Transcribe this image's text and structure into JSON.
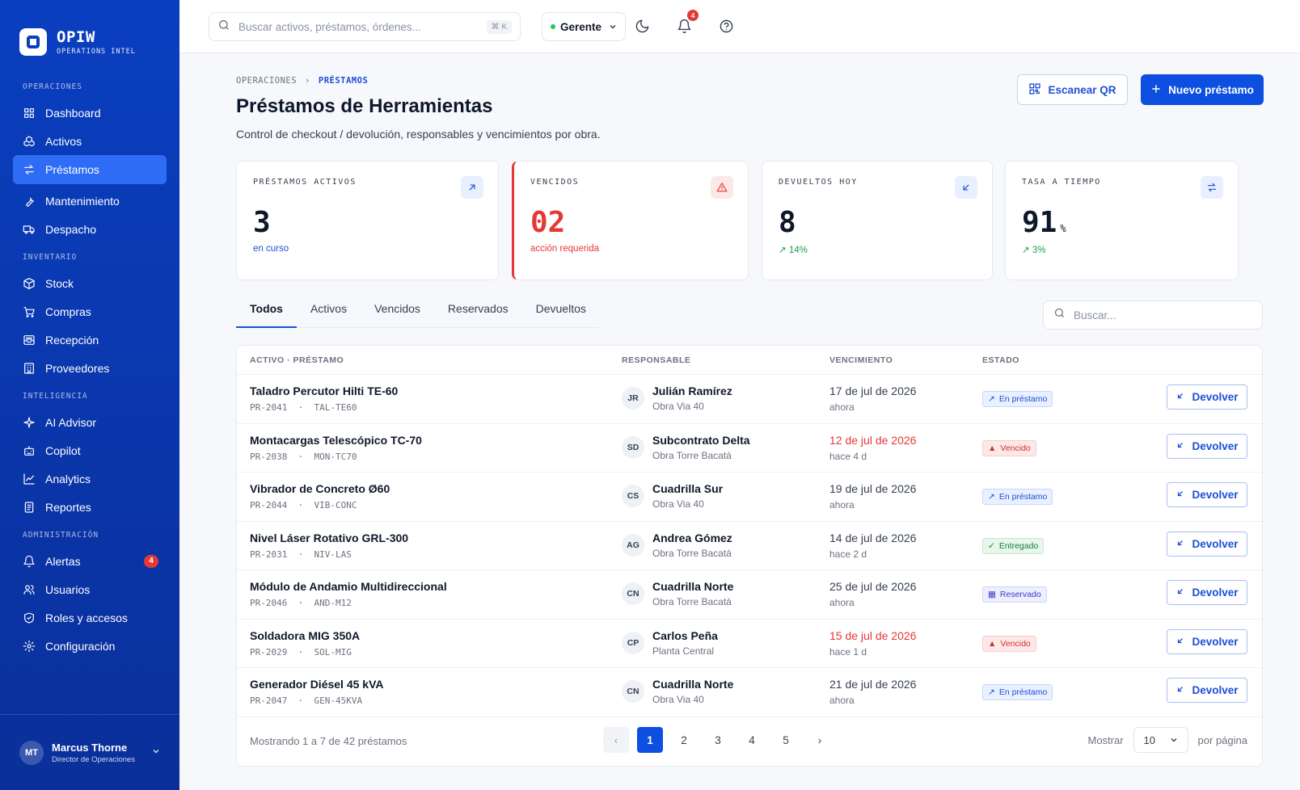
{
  "brand": {
    "name": "OPIW",
    "subtitle": "OPERATIONS INTEL"
  },
  "sidebar": {
    "sections": [
      {
        "title": "OPERACIONES",
        "items": [
          {
            "label": "Dashboard",
            "icon": "grid-icon"
          },
          {
            "label": "Activos",
            "icon": "boxes-icon"
          },
          {
            "label": "Préstamos",
            "icon": "swap-icon",
            "active": true
          },
          {
            "label": "Mantenimiento",
            "icon": "wrench-icon"
          },
          {
            "label": "Despacho",
            "icon": "truck-icon"
          }
        ]
      },
      {
        "title": "INVENTARIO",
        "items": [
          {
            "label": "Stock",
            "icon": "package-icon"
          },
          {
            "label": "Compras",
            "icon": "cart-icon"
          },
          {
            "label": "Recepción",
            "icon": "inbox-icon"
          },
          {
            "label": "Proveedores",
            "icon": "building-icon"
          }
        ]
      },
      {
        "title": "INTELIGENCIA",
        "items": [
          {
            "label": "AI Advisor",
            "icon": "sparkles-icon"
          },
          {
            "label": "Copilot",
            "icon": "bot-icon"
          },
          {
            "label": "Analytics",
            "icon": "chart-line-icon"
          },
          {
            "label": "Reportes",
            "icon": "report-icon"
          }
        ]
      },
      {
        "title": "ADMINISTRACIÓN",
        "items": [
          {
            "label": "Alertas",
            "icon": "bell-icon",
            "badge": "4"
          },
          {
            "label": "Usuarios",
            "icon": "users-icon"
          },
          {
            "label": "Roles y accesos",
            "icon": "shield-icon"
          },
          {
            "label": "Configuración",
            "icon": "gear-icon"
          }
        ]
      }
    ],
    "user": {
      "initials": "MT",
      "name": "Marcus Thorne",
      "role": "Director de Operaciones"
    }
  },
  "topbar": {
    "search_placeholder": "Buscar activos, préstamos, órdenes...",
    "shortcut": "⌘ K",
    "role": "Gerente",
    "notifications": "4"
  },
  "page": {
    "breadcrumb": [
      "OPERACIONES",
      "PRÉSTAMOS"
    ],
    "title": "Préstamos de Herramientas",
    "subtitle": "Control de checkout / devolución, responsables y vencimientos por obra.",
    "scan_button": "Escanear QR",
    "new_button": "Nuevo préstamo"
  },
  "kpis": [
    {
      "label": "PRÉSTAMOS ACTIVOS",
      "value": "3",
      "unit": "",
      "foot": "en curso",
      "tone": "blue",
      "icon": "arrow-up-right-icon"
    },
    {
      "label": "VENCIDOS",
      "value": "02",
      "unit": "",
      "foot": "acción requerida",
      "tone": "red",
      "icon": "warning-icon"
    },
    {
      "label": "DEVUELTOS HOY",
      "value": "8",
      "unit": "",
      "foot": "↗ 14%",
      "tone": "green",
      "icon": "arrow-down-left-icon"
    },
    {
      "label": "TASA A TIEMPO",
      "value": "91",
      "unit": "%",
      "foot": "↗ 3%",
      "tone": "green",
      "icon": "swap-icon"
    }
  ],
  "tabs": [
    "Todos",
    "Activos",
    "Vencidos",
    "Reservados",
    "Devueltos"
  ],
  "table_search_placeholder": "Buscar...",
  "table": {
    "headers": [
      "ACTIVO · PRÉSTAMO",
      "RESPONSABLE",
      "VENCIMIENTO",
      "ESTADO"
    ],
    "action_label": "Devolver",
    "rows": [
      {
        "asset": "Taladro Percutor Hilti TE-60",
        "loan_id": "PR-2041",
        "code": "TAL-TE60",
        "initials": "JR",
        "person": "Julián Ramírez",
        "site": "Obra Via 40",
        "due": "17 de jul de 2026",
        "rel": "ahora",
        "overdue": false,
        "status": "En préstamo",
        "tone": "blue"
      },
      {
        "asset": "Montacargas Telescópico TC-70",
        "loan_id": "PR-2038",
        "code": "MON-TC70",
        "initials": "SD",
        "person": "Subcontrato Delta",
        "site": "Obra Torre Bacatá",
        "due": "12 de jul de 2026",
        "rel": "hace 4 d",
        "overdue": true,
        "status": "Vencido",
        "tone": "red"
      },
      {
        "asset": "Vibrador de Concreto Ø60",
        "loan_id": "PR-2044",
        "code": "VIB-CONC",
        "initials": "CS",
        "person": "Cuadrilla Sur",
        "site": "Obra Via 40",
        "due": "19 de jul de 2026",
        "rel": "ahora",
        "overdue": false,
        "status": "En préstamo",
        "tone": "blue"
      },
      {
        "asset": "Nivel Láser Rotativo GRL-300",
        "loan_id": "PR-2031",
        "code": "NIV-LAS",
        "initials": "AG",
        "person": "Andrea Gómez",
        "site": "Obra Torre Bacatá",
        "due": "14 de jul de 2026",
        "rel": "hace 2 d",
        "overdue": false,
        "status": "Entregado",
        "tone": "green"
      },
      {
        "asset": "Módulo de Andamio Multidireccional",
        "loan_id": "PR-2046",
        "code": "AND-M12",
        "initials": "CN",
        "person": "Cuadrilla Norte",
        "site": "Obra Torre Bacatá",
        "due": "25 de jul de 2026",
        "rel": "ahora",
        "overdue": false,
        "status": "Reservado",
        "tone": "indigo"
      },
      {
        "asset": "Soldadora MIG 350A",
        "loan_id": "PR-2029",
        "code": "SOL-MIG",
        "initials": "CP",
        "person": "Carlos Peña",
        "site": "Planta Central",
        "due": "15 de jul de 2026",
        "rel": "hace 1 d",
        "overdue": true,
        "status": "Vencido",
        "tone": "red"
      },
      {
        "asset": "Generador Diésel 45 kVA",
        "loan_id": "PR-2047",
        "code": "GEN-45KVA",
        "initials": "CN",
        "person": "Cuadrilla Norte",
        "site": "Obra Via 40",
        "due": "21 de jul de 2026",
        "rel": "ahora",
        "overdue": false,
        "status": "En préstamo",
        "tone": "blue"
      }
    ]
  },
  "pagination": {
    "summary": "Mostrando 1 a 7 de 42 préstamos",
    "pages": [
      "1",
      "2",
      "3",
      "4",
      "5"
    ],
    "current": "1",
    "show_label": "Mostrar",
    "per_page": "10",
    "per_page_suffix": "por página"
  }
}
